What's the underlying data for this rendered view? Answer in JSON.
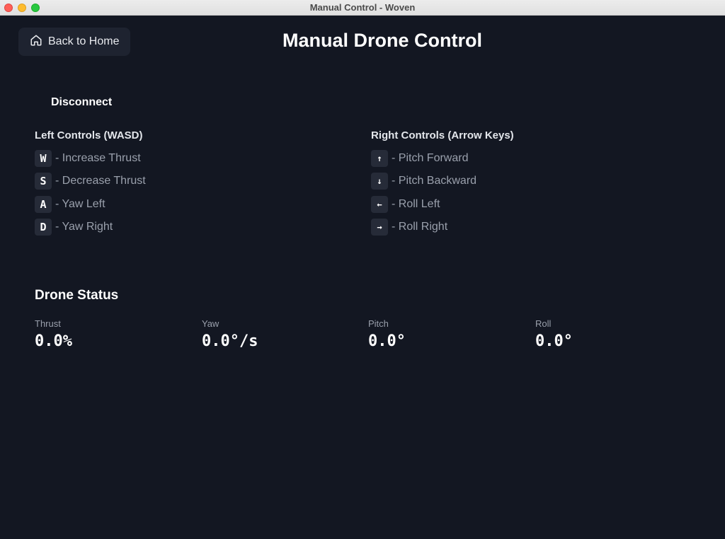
{
  "window": {
    "title": "Manual Control - Woven"
  },
  "header": {
    "back_button": "Back to Home",
    "title": "Manual Drone Control"
  },
  "connection": {
    "disconnect_label": "Disconnect"
  },
  "left_controls": {
    "heading": "Left Controls (WASD)",
    "items": [
      {
        "key": "W",
        "label": "- Increase Thrust"
      },
      {
        "key": "S",
        "label": "- Decrease Thrust"
      },
      {
        "key": "A",
        "label": "- Yaw Left"
      },
      {
        "key": "D",
        "label": "- Yaw Right"
      }
    ]
  },
  "right_controls": {
    "heading": "Right Controls (Arrow Keys)",
    "items": [
      {
        "key": "↑",
        "label": "- Pitch Forward"
      },
      {
        "key": "↓",
        "label": "- Pitch Backward"
      },
      {
        "key": "←",
        "label": "- Roll Left"
      },
      {
        "key": "→",
        "label": "- Roll Right"
      }
    ]
  },
  "status": {
    "heading": "Drone Status",
    "thrust": {
      "label": "Thrust",
      "value": "0.0%"
    },
    "yaw": {
      "label": "Yaw",
      "value": "0.0°/s"
    },
    "pitch": {
      "label": "Pitch",
      "value": "0.0°"
    },
    "roll": {
      "label": "Roll",
      "value": "0.0°"
    }
  },
  "colors": {
    "background": "#131722",
    "panel": "#1e2330",
    "key_bg": "#262b38",
    "muted_text": "#9aa0ac"
  },
  "icons": {
    "back_button": "home-icon"
  }
}
